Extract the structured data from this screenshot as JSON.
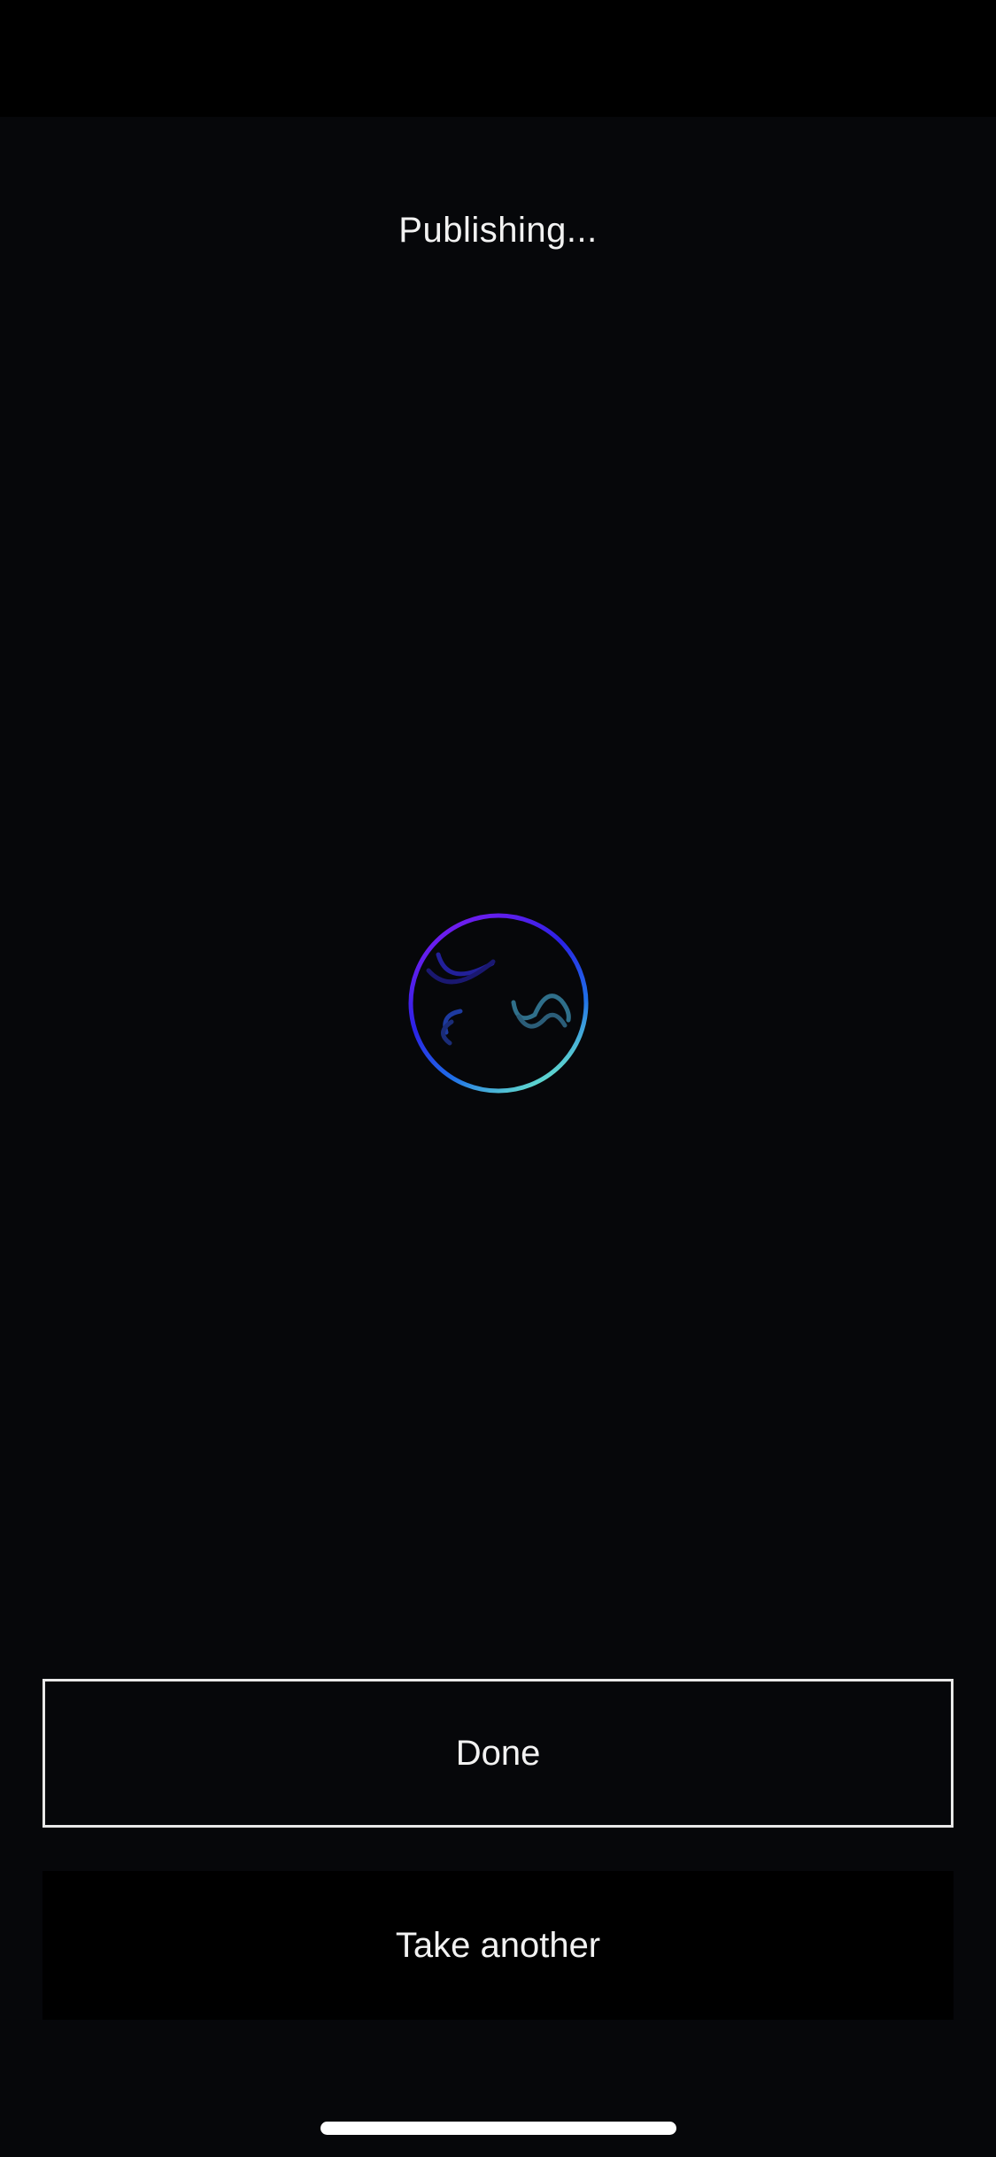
{
  "header": {
    "title": "Publishing..."
  },
  "loader": {
    "icon": "publishing-spinner-icon",
    "gradient_colors": [
      "#7a1cf0",
      "#2a22e6",
      "#1f6fe8",
      "#6ef0c8"
    ]
  },
  "actions": {
    "done_label": "Done",
    "take_another_label": "Take another"
  }
}
